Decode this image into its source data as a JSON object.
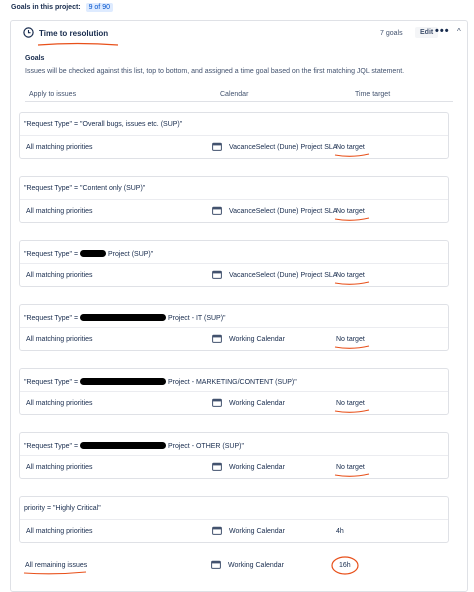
{
  "header": {
    "label": "Goals in this project:",
    "count": "9 of 90"
  },
  "panel": {
    "title": "Time to resolution",
    "goal_count": "7 goals",
    "edit_label": "Edit",
    "more_label": "•••",
    "collapse_label": "^"
  },
  "goals": {
    "label": "Goals",
    "description": "Issues will be checked against this list, top to bottom, and assigned a time goal based on the first matching JQL statement.",
    "columns": [
      "Apply to issues",
      "Calendar",
      "Time target"
    ]
  },
  "rules": [
    {
      "query_prefix": "\"Request Type\" = \"Overall bugs, issues etc. (SUP)\"",
      "query_suffix": "",
      "apply": "All matching priorities",
      "calendar": "VacanceSelect (Dune) Project SLA",
      "target": "No target"
    },
    {
      "query_prefix": "\"Request Type\" = \"Content only (SUP)\"",
      "query_suffix": "",
      "apply": "All matching priorities",
      "calendar": "VacanceSelect (Dune) Project SLA",
      "target": "No target"
    },
    {
      "query_prefix": "\"Request Type\" = ",
      "query_suffix": " Project (SUP)\"",
      "apply": "All matching priorities",
      "calendar": "VacanceSelect (Dune) Project SLA",
      "target": "No target"
    },
    {
      "query_prefix": "\"Request Type\" = ",
      "query_suffix": " Project - IT (SUP)\"",
      "apply": "All matching priorities",
      "calendar": "Working Calendar",
      "target": "No target"
    },
    {
      "query_prefix": "\"Request Type\" = ",
      "query_suffix": " Project - MARKETING/CONTENT (SUP)\"",
      "apply": "All matching priorities",
      "calendar": "Working Calendar",
      "target": "No target"
    },
    {
      "query_prefix": "\"Request Type\" = ",
      "query_suffix": " Project - OTHER (SUP)\"",
      "apply": "All matching priorities",
      "calendar": "Working Calendar",
      "target": "No target"
    },
    {
      "query_prefix": "priority = \"Highly Critical\"",
      "query_suffix": "",
      "apply": "All matching priorities",
      "calendar": "Working Calendar",
      "target": "4h"
    }
  ],
  "final_row": {
    "apply": "All remaining issues",
    "calendar": "Working Calendar",
    "target": "16h"
  },
  "colors": {
    "annotation": "#e8501a",
    "badge_bg": "#deebff",
    "border": "#dfe1e6"
  }
}
